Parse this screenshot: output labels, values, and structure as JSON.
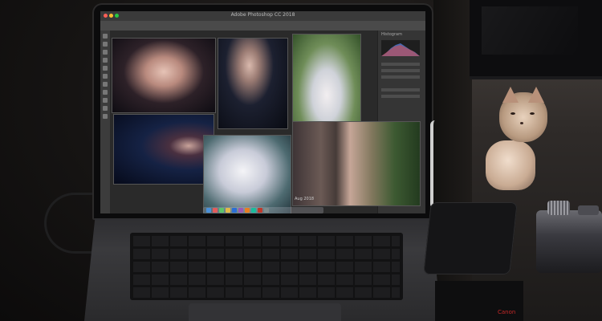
{
  "scene": {
    "screen": {
      "app_title": "Adobe Photoshop CC 2018",
      "panel_tab": "Histogram",
      "photo_caption": "Aug 2018"
    },
    "camera": {
      "brand": "Canon"
    },
    "icons": {
      "photoshop": "ps-window-icon",
      "dock": "macos-dock-icon"
    },
    "colors": {
      "screen_bg": "#262626",
      "laptop": "#2e2e31",
      "cat": "#e8d2bd",
      "brand_red": "#c62828"
    }
  }
}
